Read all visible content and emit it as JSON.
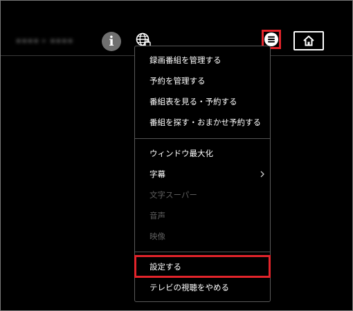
{
  "header": {
    "program_title": "▪▪▪▪ ▸ ▪▪▪▪",
    "info_label": "i",
    "icons": {
      "info": "info-icon",
      "globe": "globe-icon",
      "menu": "menu-icon",
      "home": "home-icon"
    }
  },
  "menu": {
    "group1": [
      {
        "label": "録画番組を管理する",
        "enabled": true
      },
      {
        "label": "予約を管理する",
        "enabled": true
      },
      {
        "label": "番組表を見る・予約する",
        "enabled": true
      },
      {
        "label": "番組を探す・おまかせ予約する",
        "enabled": true
      }
    ],
    "group2": [
      {
        "label": "ウィンドウ最大化",
        "enabled": true
      },
      {
        "label": "字幕",
        "enabled": true,
        "has_submenu": true
      },
      {
        "label": "文字スーパー",
        "enabled": false
      },
      {
        "label": "音声",
        "enabled": false
      },
      {
        "label": "映像",
        "enabled": false
      }
    ],
    "group3": [
      {
        "label": "設定する",
        "enabled": true,
        "highlighted": true
      },
      {
        "label": "テレビの視聴をやめる",
        "enabled": true
      }
    ]
  },
  "colors": {
    "background": "#000000",
    "highlight": "#e3242b",
    "disabled_text": "#5e5e5e",
    "text": "#ffffff"
  }
}
